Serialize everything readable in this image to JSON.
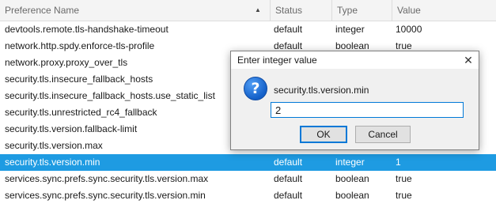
{
  "table": {
    "columns": {
      "preference": "Preference Name",
      "status": "Status",
      "type": "Type",
      "value": "Value"
    },
    "sort_icon": "sort-ascending-icon",
    "rows": [
      {
        "name": "devtools.remote.tls-handshake-timeout",
        "status": "default",
        "type": "integer",
        "value": "10000"
      },
      {
        "name": "network.http.spdy.enforce-tls-profile",
        "status": "default",
        "type": "boolean",
        "value": "true"
      },
      {
        "name": "network.proxy.proxy_over_tls",
        "status": "",
        "type": "",
        "value": ""
      },
      {
        "name": "security.tls.insecure_fallback_hosts",
        "status": "",
        "type": "",
        "value": ""
      },
      {
        "name": "security.tls.insecure_fallback_hosts.use_static_list",
        "status": "",
        "type": "",
        "value": ""
      },
      {
        "name": "security.tls.unrestricted_rc4_fallback",
        "status": "",
        "type": "",
        "value": ""
      },
      {
        "name": "security.tls.version.fallback-limit",
        "status": "",
        "type": "",
        "value": ""
      },
      {
        "name": "security.tls.version.max",
        "status": "",
        "type": "",
        "value": ""
      },
      {
        "name": "security.tls.version.min",
        "status": "default",
        "type": "integer",
        "value": "1",
        "selected": true
      },
      {
        "name": "services.sync.prefs.sync.security.tls.version.max",
        "status": "default",
        "type": "boolean",
        "value": "true"
      },
      {
        "name": "services.sync.prefs.sync.security.tls.version.min",
        "status": "default",
        "type": "boolean",
        "value": "true"
      }
    ]
  },
  "dialog": {
    "title": "Enter integer value",
    "icon": "question-icon",
    "label": "security.tls.version.min",
    "input_value": "2",
    "ok_label": "OK",
    "cancel_label": "Cancel"
  },
  "colors": {
    "selection": "#1e9be2",
    "focus_border": "#0078d7"
  }
}
